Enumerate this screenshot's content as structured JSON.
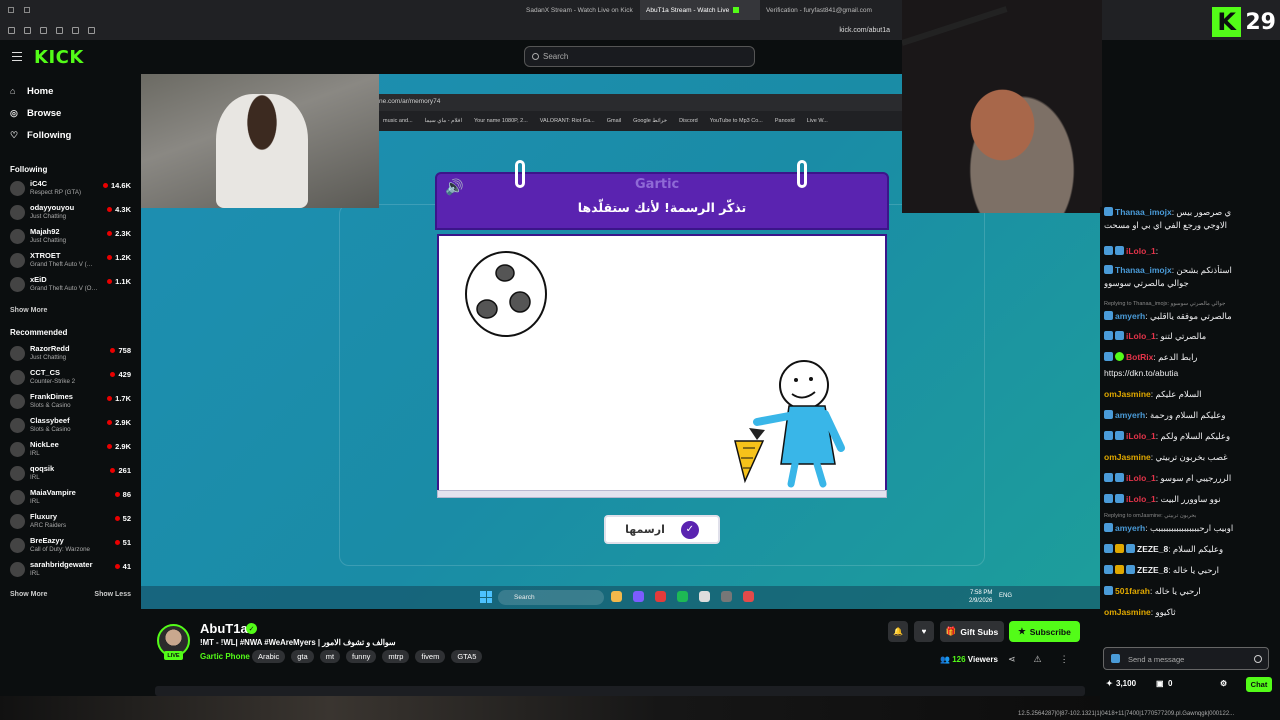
{
  "browser": {
    "tabs": [
      {
        "label": "SadanX Stream - Watch Live on Kick",
        "active": false
      },
      {
        "label": "AbuT1a Stream - Watch Live",
        "active": true
      },
      {
        "label": "Verification - furyfast841@gmail.com",
        "active": false
      }
    ],
    "url": "kick.com/abut1a"
  },
  "header": {
    "logo": "KICK",
    "search_placeholder": "Search"
  },
  "badge": {
    "letter": "K",
    "number": "29"
  },
  "sidebar": {
    "nav": [
      {
        "label": "Home",
        "icon": "home-icon"
      },
      {
        "label": "Browse",
        "icon": "compass-icon"
      },
      {
        "label": "Following",
        "icon": "heart-icon"
      }
    ],
    "following_title": "Following",
    "following": [
      {
        "name": "iC4C",
        "category": "Respect RP (GTA)",
        "viewers": "14.6K"
      },
      {
        "name": "odayyouyou",
        "category": "Just Chatting",
        "viewers": "4.3K"
      },
      {
        "name": "Majah92",
        "category": "Just Chatting",
        "viewers": "2.3K"
      },
      {
        "name": "XTROET",
        "category": "Grand Theft Auto V (…",
        "viewers": "1.2K"
      },
      {
        "name": "xEiD",
        "category": "Grand Theft Auto V (O…",
        "viewers": "1.1K"
      }
    ],
    "show_more_1": "Show More",
    "recommended_title": "Recommended",
    "recommended": [
      {
        "name": "RazorRedd",
        "category": "Just Chatting",
        "viewers": "758"
      },
      {
        "name": "CCT_CS",
        "category": "Counter-Strike 2",
        "viewers": "429"
      },
      {
        "name": "FrankDimes",
        "category": "Slots & Casino",
        "viewers": "1.7K"
      },
      {
        "name": "Classybeef",
        "category": "Slots & Casino",
        "viewers": "2.9K"
      },
      {
        "name": "NickLee",
        "category": "IRL",
        "viewers": "2.9K"
      },
      {
        "name": "qoqsik",
        "category": "IRL",
        "viewers": "261"
      },
      {
        "name": "MaiaVampire",
        "category": "IRL",
        "viewers": "86"
      },
      {
        "name": "Fluxury",
        "category": "ARC Raiders",
        "viewers": "52"
      },
      {
        "name": "BreEazyy",
        "category": "Call of Duty: Warzone",
        "viewers": "51"
      },
      {
        "name": "sarahbridgewater",
        "category": "IRL",
        "viewers": "41"
      }
    ],
    "show_more_2": "Show More",
    "show_less": "Show Less"
  },
  "video": {
    "inner_url": "ne.com/ar/memory74",
    "bookmarks": [
      "music and...",
      "افلام - ماي سيما",
      "Your name 1080P, 2...",
      "VALORANT: Riot Ga...",
      "Gmail",
      "Google خرائط",
      "Discord",
      "YouTube to Mp3 Co...",
      "Panoxid",
      "Live W..."
    ],
    "gartic_logo": "Gartic",
    "prompt": "تذكّر الرسمة! لأنك ستقلّدها",
    "draw_button": "ارسمها",
    "taskbar_search": "Search",
    "tray_lang": "ENG",
    "tray_time": "7:58 PM",
    "tray_date": "2/9/2026"
  },
  "chat": {
    "messages": [
      {
        "user": "Thanaa_imojx",
        "text": "ي صرصور بيس",
        "color": "#4a9bd8",
        "badges": [
          "blue"
        ]
      },
      {
        "user": "",
        "text": "الاوجي ورجع الفي اي بي او مسحت",
        "color": "#efeff1",
        "badges": []
      },
      {
        "user": "iLolo_1",
        "text": "",
        "color": "#e5344a",
        "badges": [
          "blue",
          "blue"
        ]
      },
      {
        "user": "Thanaa_imojx",
        "text": "استأذنكم بشحن",
        "color": "#4a9bd8",
        "badges": [
          "blue"
        ]
      },
      {
        "user": "",
        "text": "جوالي مالصرتي سوسوو",
        "color": "#efeff1",
        "badges": []
      },
      {
        "user": "amyerh",
        "text": "مالصرتي موفقه يااقلبي",
        "color": "#4a9bd8",
        "badges": [
          "blue"
        ],
        "reply": "Replying to Thanaa_imojx: جوالي مالصرتي سوسوو"
      },
      {
        "user": "iLolo_1",
        "text": "مالصرتي لتنو",
        "color": "#e5344a",
        "badges": [
          "blue",
          "blue"
        ]
      },
      {
        "user": "BotRix",
        "text": "رابط الدعم",
        "color": "#e5344a",
        "badges": [
          "blue",
          "green"
        ]
      },
      {
        "user": "",
        "text": "https://dkn.to/abutia",
        "color": "#efeff1",
        "badges": []
      },
      {
        "user": "omJasmine",
        "text": "السلام عليكم",
        "color": "#e0a800",
        "badges": []
      },
      {
        "user": "amyerh",
        "text": "وعليكم السلام ورحمة",
        "color": "#4a9bd8",
        "badges": [
          "blue"
        ]
      },
      {
        "user": "iLolo_1",
        "text": "وعليكم السلام ولكم",
        "color": "#e5344a",
        "badges": [
          "blue",
          "blue"
        ]
      },
      {
        "user": "omJasmine",
        "text": "غصب بخربون تربيتي",
        "color": "#e0a800",
        "badges": []
      },
      {
        "user": "iLolo_1",
        "text": "الرررجيبي ام سوسو",
        "color": "#e5344a",
        "badges": [
          "blue",
          "blue"
        ]
      },
      {
        "user": "iLolo_1",
        "text": "نوو ساوورر البيت",
        "color": "#e5344a",
        "badges": [
          "blue",
          "blue"
        ]
      },
      {
        "user": "amyerh",
        "text": "اوبيب ارحببببببببببببببببب",
        "color": "#4a9bd8",
        "badges": [
          "blue"
        ],
        "reply": "Replying to omJasmine: بخربون تربيتي"
      },
      {
        "user": "ZEZE_8",
        "text": "وعليكم السلام",
        "color": "#efeff1",
        "badges": [
          "blue",
          "gold",
          "blue"
        ]
      },
      {
        "user": "ZEZE_8",
        "text": "ارحبي يا خاله",
        "color": "#efeff1",
        "badges": [
          "blue",
          "gold",
          "blue"
        ]
      },
      {
        "user": "501farah",
        "text": "ارحبي يا خاله",
        "color": "#e0a800",
        "badges": [
          "blue"
        ]
      },
      {
        "user": "omJasmine",
        "text": "ثاكيوو",
        "color": "#e0a800",
        "badges": []
      }
    ],
    "input_placeholder": "Send a message",
    "points": "3,100",
    "chests": "0",
    "chat_button": "Chat"
  },
  "stream": {
    "streamer": "AbuT1a",
    "live": "LIVE",
    "title": "!MT - !WL| #NWA #WeAreMyers | سوالف و تشوف الامور",
    "category": "Gartic Phone",
    "tags": [
      "Arabic",
      "gta",
      "mt",
      "funny",
      "mtrp",
      "fivem",
      "GTA5"
    ],
    "gift_subs": "Gift Subs",
    "subscribe": "Subscribe",
    "viewers_count": "126",
    "viewers_label": "Viewers"
  },
  "status": "12.5.2564287|0|87-102.1321|1|0418+11|7400|1770577209.pl.Gawnqgk|000122..."
}
